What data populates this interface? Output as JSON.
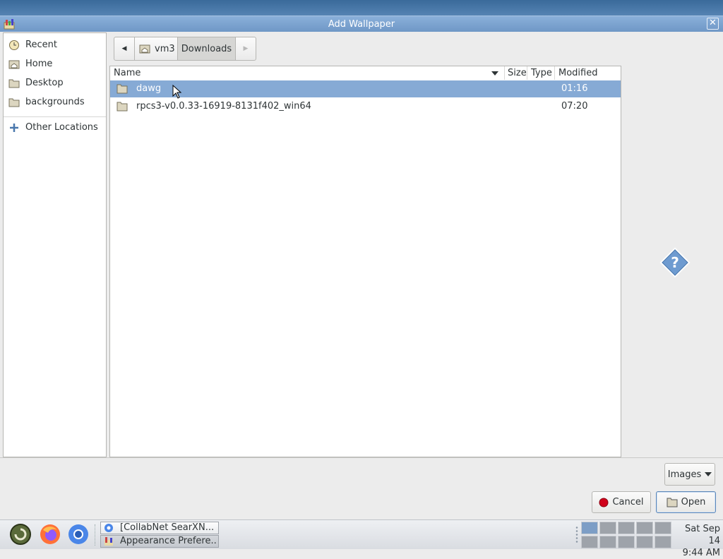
{
  "window": {
    "title": "Add Wallpaper",
    "close_glyph": "✕"
  },
  "sidebar": {
    "items": [
      {
        "label": "Recent",
        "icon": "clock-icon"
      },
      {
        "label": "Home",
        "icon": "home-folder-icon"
      },
      {
        "label": "Desktop",
        "icon": "folder-icon"
      },
      {
        "label": "backgrounds",
        "icon": "folder-icon"
      },
      {
        "label": "Other Locations",
        "icon": "plus-icon"
      }
    ]
  },
  "pathbar": {
    "back_glyph": "◀",
    "forward_glyph": "▶",
    "crumbs": [
      "vm3",
      "Downloads"
    ]
  },
  "filelist": {
    "columns": [
      "Name",
      "Size",
      "Type",
      "Modified"
    ],
    "rows": [
      {
        "name": "dawg",
        "size": "",
        "type": "",
        "modified": "01:16",
        "selected": true
      },
      {
        "name": "rpcs3-v0.0.33-16919-8131f402_win64",
        "size": "",
        "type": "",
        "modified": "07:20",
        "selected": false
      }
    ]
  },
  "filter": {
    "value": "Images"
  },
  "buttons": {
    "cancel": "Cancel",
    "open": "Open"
  },
  "taskbar": {
    "tasks": [
      {
        "label": "[CollabNet SearXN...",
        "active": false
      },
      {
        "label": "Appearance Prefere...",
        "active": true
      }
    ],
    "clock": {
      "date": "Sat Sep 14",
      "time": "9:44 AM"
    }
  },
  "colors": {
    "selection": "#86aad5",
    "titlebar": "#7ba2d0"
  }
}
